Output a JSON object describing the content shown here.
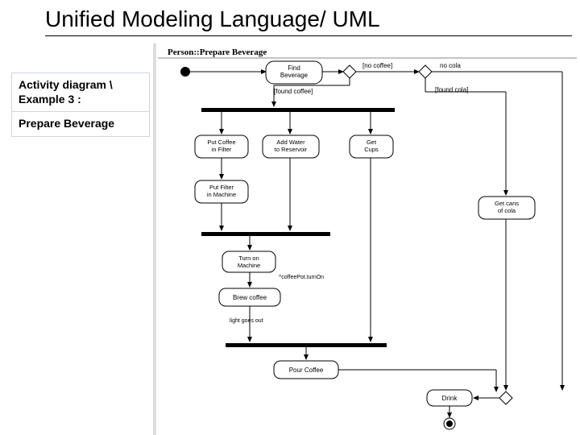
{
  "title": "Unified Modeling Language/ UML",
  "left_note": {
    "line1": "Activity diagram \\",
    "line2": "Example 3 :",
    "line3": "Prepare Beverage"
  },
  "swimlane_header": "Person::Prepare Beverage",
  "nodes": {
    "find_beverage": "Find\nBeverage",
    "put_coffee": "Put Coffee\nin Filter",
    "add_water": "Add Water\nto Reservoir",
    "get_cups": "Get\nCups",
    "put_filter": "Put Filter\nin Machine",
    "get_cans": "Get cans\nof cola",
    "turn_on": "Turn on\nMachine",
    "brew": "Brew coffee",
    "pour": "Pour Coffee",
    "drink": "Drink"
  },
  "guards": {
    "no_coffee": "[no coffee]",
    "no_cola": "no cola",
    "found_coffee": "[found coffee]",
    "found_cola": "[found cola]"
  },
  "labels": {
    "coffee_turn_on": "^coffeePot.turnOn",
    "light_out": "light goes out"
  }
}
